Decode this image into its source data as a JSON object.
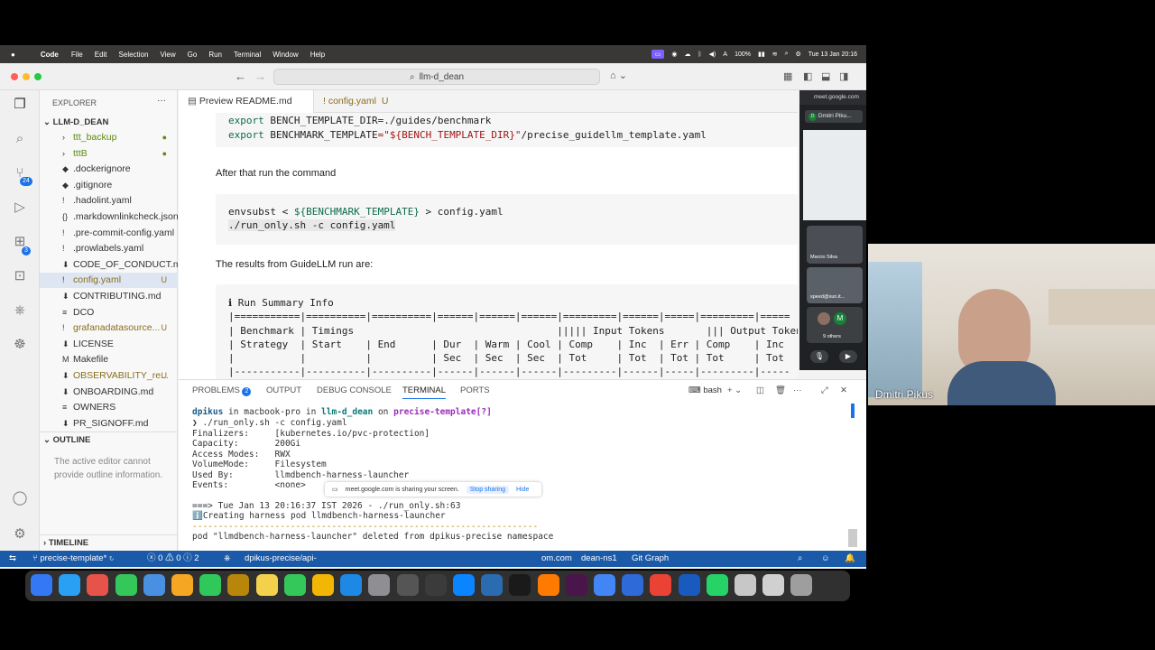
{
  "menubar": {
    "app": "Code",
    "items": [
      "File",
      "Edit",
      "Selection",
      "View",
      "Go",
      "Run",
      "Terminal",
      "Window",
      "Help"
    ],
    "battery": "100%",
    "datetime": "Tue 13 Jan 20:16"
  },
  "titlebar": {
    "search": "llm-d_dean"
  },
  "activity": {
    "scm_badge": "24",
    "ext_badge": "3"
  },
  "explorer": {
    "title": "EXPLORER",
    "root": "LLM-D_DEAN",
    "files": [
      {
        "name": "ttt_backup",
        "icon": "›",
        "status": "●",
        "color": "#5e8a10"
      },
      {
        "name": "tttB",
        "icon": "›",
        "status": "●",
        "color": "#5e8a10"
      },
      {
        "name": ".dockerignore",
        "icon": "◆",
        "status": "",
        "color": "#333"
      },
      {
        "name": ".gitignore",
        "icon": "◆",
        "status": "",
        "color": "#333"
      },
      {
        "name": ".hadolint.yaml",
        "icon": "!",
        "status": "",
        "color": "#333"
      },
      {
        "name": ".markdownlinkcheck.json",
        "icon": "{}",
        "status": "",
        "color": "#333"
      },
      {
        "name": ".pre-commit-config.yaml",
        "icon": "!",
        "status": "",
        "color": "#333"
      },
      {
        "name": ".prowlabels.yaml",
        "icon": "!",
        "status": "",
        "color": "#333"
      },
      {
        "name": "CODE_OF_CONDUCT.md",
        "icon": "⬇",
        "status": "",
        "color": "#333"
      },
      {
        "name": "config.yaml",
        "icon": "!",
        "status": "U",
        "color": "#8a6d1c"
      },
      {
        "name": "CONTRIBUTING.md",
        "icon": "⬇",
        "status": "",
        "color": "#333"
      },
      {
        "name": "DCO",
        "icon": "≡",
        "status": "",
        "color": "#333"
      },
      {
        "name": "grafanadatasource...",
        "icon": "!",
        "status": "U",
        "color": "#8a6d1c"
      },
      {
        "name": "LICENSE",
        "icon": "⬇",
        "status": "",
        "color": "#333"
      },
      {
        "name": "Makefile",
        "icon": "M",
        "status": "",
        "color": "#333"
      },
      {
        "name": "OBSERVABILITY_re...",
        "icon": "⬇",
        "status": "U",
        "color": "#8a6d1c"
      },
      {
        "name": "ONBOARDING.md",
        "icon": "⬇",
        "status": "",
        "color": "#333"
      },
      {
        "name": "OWNERS",
        "icon": "≡",
        "status": "",
        "color": "#333"
      },
      {
        "name": "PR_SIGNOFF.md",
        "icon": "⬇",
        "status": "",
        "color": "#333"
      }
    ],
    "outline_title": "OUTLINE",
    "outline_msg": "The active editor cannot provide outline information.",
    "timeline_title": "TIMELINE"
  },
  "tabs": [
    {
      "label": "Preview README.md",
      "close": "✕"
    },
    {
      "label": "config.yaml",
      "status": "U"
    }
  ],
  "preview": {
    "line1_export": "export",
    "line1_var": "BENCH_TEMPLATE_DIR",
    "line1_rest": "=./guides/benchmark",
    "line2_export": "export",
    "line2_var": "BENCHMARK_TEMPLATE",
    "line2_str": "=\"${BENCH_TEMPLATE_DIR}\"",
    "line2_rest": "/precise_guidellm_template.yaml",
    "para1": "After that run the command",
    "cmd1_a": "envsubst < ",
    "cmd1_var": "${BENCHMARK_TEMPLATE}",
    "cmd1_b": " > config.yaml",
    "cmd2": "./run_only.sh -c config.yaml",
    "para2": "The results from GuideLLM run are:",
    "table": [
      "ℹ Run Summary Info",
      "|===========|==========|==========|======|======|======|=========|======|=====|=========|=====",
      "| Benchmark | Timings                                  ||||| Input Tokens       ||| Output Tokens",
      "| Strategy  | Start    | End      | Dur  | Warm | Cool | Comp    | Inc  | Err | Comp    | Inc",
      "|           |          |          | Sec  | Sec  | Sec  | Tot     | Tot  | Tot | Tot     | Tot",
      "|-----------|----------|----------|------|------|------|---------|------|-----|---------|-----"
    ]
  },
  "panel": {
    "tabs": [
      "PROBLEMS",
      "OUTPUT",
      "DEBUG CONSOLE",
      "TERMINAL",
      "PORTS"
    ],
    "problems_count": "2",
    "shell": "bash",
    "prompt_user": "dpikus",
    "prompt_in": " in ",
    "prompt_host": "macbook-pro",
    "prompt_in2": " in ",
    "prompt_dir": "llm-d_dean",
    "prompt_on": " on ",
    "prompt_branch": "precise-template[?]",
    "command": "❯ ./run_only.sh -c config.yaml",
    "output": [
      "Finalizers:     [kubernetes.io/pvc-protection]",
      "Capacity:       200Gi",
      "Access Modes:   RWX",
      "VolumeMode:     Filesystem",
      "Used By:        llmdbench-harness-launcher",
      "Events:         <none>",
      "",
      "===> Tue Jan 13 20:16:37 IST 2026 - ./run_only.sh:63",
      "ℹ️Creating harness pod llmdbench-harness-launcher",
      "-------------------------------------------------------------------",
      "pod \"llmdbench-harness-launcher\" deleted from dpikus-precise namespace"
    ]
  },
  "statusbar": {
    "branch": "precise-template*",
    "errors": "0",
    "warnings": "0",
    "info": "2",
    "api": "dpikus-precise/api-",
    "domain": "om.com",
    "ns": "dean-ns1",
    "git": "Git Graph"
  },
  "meet_banner": {
    "text": "meet.google.com is sharing your screen.",
    "stop": "Stop sharing",
    "hide": "Hide"
  },
  "meet": {
    "url": "meet.google.com",
    "presenter": "Dmitri Piku...",
    "p1": "Marcio Silva",
    "p2": "speed@sun.it...",
    "others_initial": "M",
    "others": "9 others",
    "participant_name": "Dmitri Pikus"
  },
  "dock_colors": [
    "#3478f6",
    "#2aa0f5",
    "#e5534b",
    "#34c759",
    "#4a90e2",
    "#f5a623",
    "#30c85a",
    "#b8860b",
    "#f3d14c",
    "#34c759",
    "#f2b705",
    "#1e88e5",
    "#8e8e93",
    "#555",
    "#3b3b3b",
    "#0a84ff",
    "#2b6cb0",
    "#1a1a1a",
    "#ff7a00",
    "#4a154b",
    "#4285f4",
    "#2e6ad8",
    "#ea4335",
    "#185abd",
    "#25d366",
    "#c7c7c7",
    "#d0d0d0",
    "#9e9e9e"
  ]
}
